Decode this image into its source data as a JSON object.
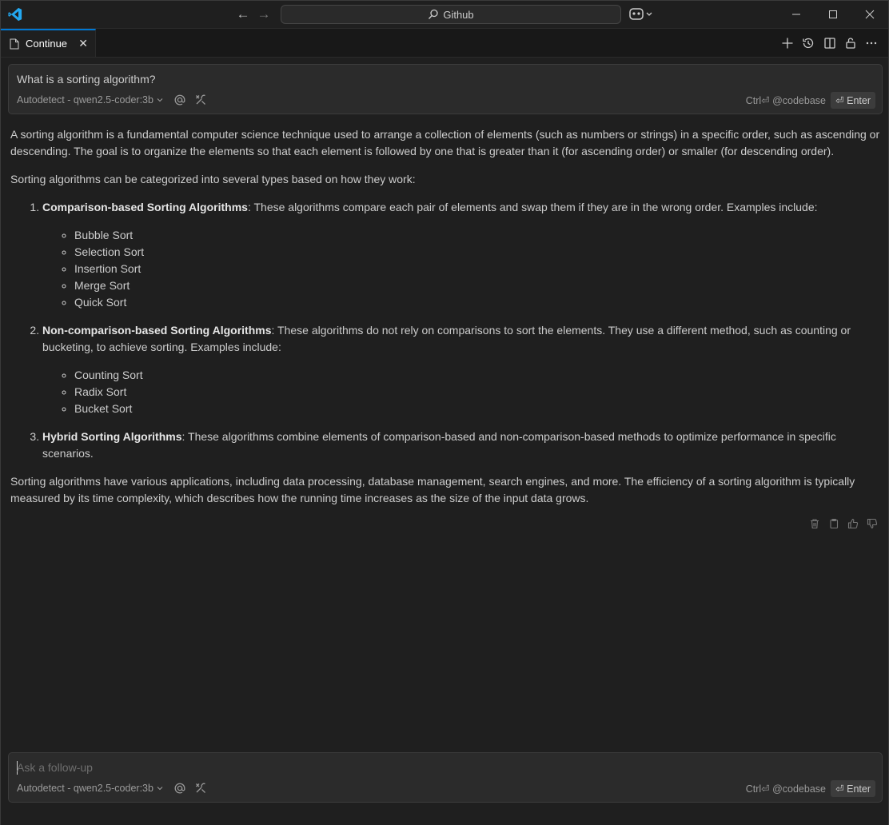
{
  "titlebar": {
    "search_text": "Github",
    "icons": [
      "vscode-logo-icon",
      "back-arrow-icon",
      "forward-arrow-icon",
      "search-icon",
      "copilot-icon",
      "minimize-icon",
      "maximize-icon",
      "close-icon"
    ]
  },
  "tab": {
    "label": "Continue",
    "actions": [
      "new-session-icon",
      "history-icon",
      "split-view-icon",
      "lock-icon",
      "more-icon"
    ]
  },
  "query": {
    "text": "What is a sorting algorithm?",
    "model": "Autodetect - qwen2.5-coder:3b",
    "codebase_hint": "Ctrl⏎ @codebase",
    "enter_label": "⏎ Enter"
  },
  "answer": {
    "intro": "A sorting algorithm is a fundamental computer science technique used to arrange a collection of elements (such as numbers or strings) in a specific order, such as ascending or descending. The goal is to organize the elements so that each element is followed by one that is greater than it (for ascending order) or smaller (for descending order).",
    "categories_intro": "Sorting algorithms can be categorized into several types based on how they work:",
    "items": [
      {
        "title": "Comparison-based Sorting Algorithms",
        "desc": ": These algorithms compare each pair of elements and swap them if they are in the wrong order. Examples include:",
        "examples": [
          "Bubble Sort",
          "Selection Sort",
          "Insertion Sort",
          "Merge Sort",
          "Quick Sort"
        ]
      },
      {
        "title": "Non-comparison-based Sorting Algorithms",
        "desc": ": These algorithms do not rely on comparisons to sort the elements. They use a different method, such as counting or bucketing, to achieve sorting. Examples include:",
        "examples": [
          "Counting Sort",
          "Radix Sort",
          "Bucket Sort"
        ]
      },
      {
        "title": "Hybrid Sorting Algorithms",
        "desc": ": These algorithms combine elements of comparison-based and non-comparison-based methods to optimize performance in specific scenarios."
      }
    ],
    "outro": "Sorting algorithms have various applications, including data processing, database management, search engines, and more. The efficiency of a sorting algorithm is typically measured by its time complexity, which describes how the running time increases as the size of the input data grows.",
    "actions": [
      "delete-icon",
      "copy-icon",
      "thumbs-up-icon",
      "thumbs-down-icon"
    ]
  },
  "followup": {
    "placeholder": "Ask a follow-up",
    "model": "Autodetect - qwen2.5-coder:3b",
    "codebase_hint": "Ctrl⏎ @codebase",
    "enter_label": "⏎ Enter"
  },
  "colors": {
    "background": "#1f1f1f",
    "tab_accent": "#0078d4",
    "vscode_blue": "#23a9f2",
    "card": "#2b2b2b",
    "text": "#cccccc"
  }
}
